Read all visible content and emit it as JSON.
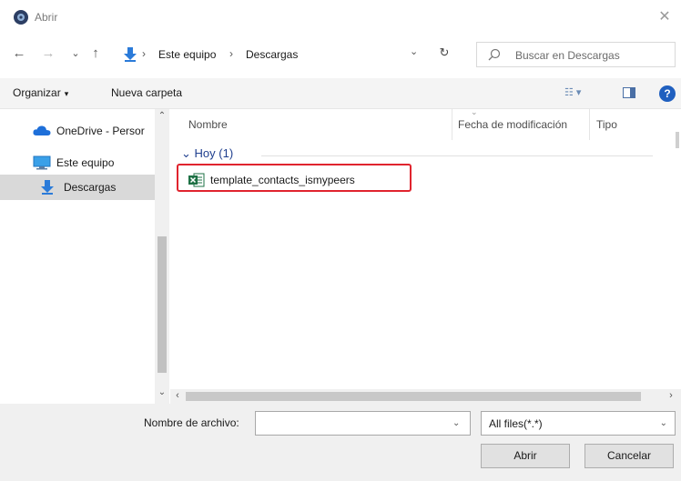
{
  "window": {
    "title": "Abrir",
    "close_glyph": "✕"
  },
  "nav": {
    "back_glyph": "←",
    "forward_glyph": "→",
    "recent_glyph": "⌄",
    "up_glyph": "↑",
    "breadcrumb": [
      "Este equipo",
      "Descargas"
    ],
    "separator": "›",
    "dropdown_glyph": "⌄",
    "refresh_glyph": "↻",
    "search_placeholder": "Buscar en Descargas"
  },
  "toolbar": {
    "organize_label": "Organizar",
    "organize_caret": "▾",
    "new_folder_label": "Nueva carpeta",
    "view_glyph": "☷ ▾",
    "help_glyph": "?"
  },
  "sidebar": {
    "items": [
      {
        "label": "OneDrive - Persor",
        "icon": "cloud-icon"
      },
      {
        "label": "Este equipo",
        "icon": "monitor-icon"
      },
      {
        "label": "Descargas",
        "icon": "download-arrow-icon",
        "selected": true
      }
    ],
    "scroll_up": "⌃",
    "scroll_down": "⌄"
  },
  "file_list": {
    "columns": [
      "Nombre",
      "Fecha de modificación",
      "Tipo"
    ],
    "sort_caret": "⌄",
    "groups": [
      {
        "header": "Hoy (1)",
        "toggle": "⌄",
        "files": [
          {
            "name": "template_contacts_ismypeers",
            "icon": "excel-file-icon"
          }
        ]
      }
    ],
    "hscroll_left": "‹",
    "hscroll_right": "›"
  },
  "footer": {
    "filename_label": "Nombre de archivo:",
    "filename_value": "",
    "filename_dropdown": "⌄",
    "filter_value": "All files(*.*)",
    "filter_dropdown": "⌄",
    "open_label": "Abrir",
    "cancel_label": "Cancelar"
  },
  "colors": {
    "accent": "#1f5fbf",
    "highlight_border": "#e0242e",
    "group_header": "#1e3e8e",
    "selected_bg": "#d9d9d9"
  }
}
